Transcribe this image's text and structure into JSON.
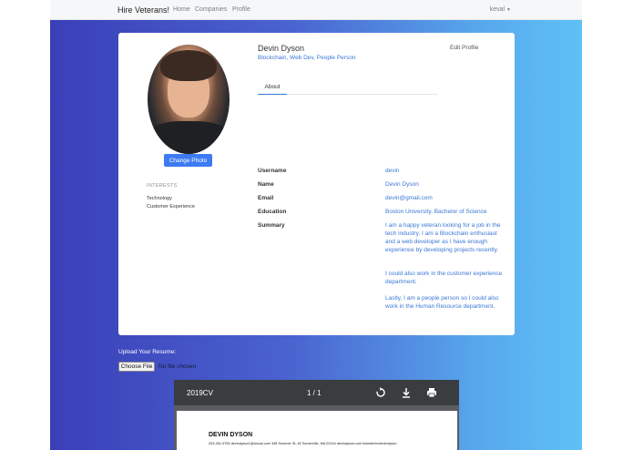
{
  "navbar": {
    "brand": "Hire Veterans!",
    "links": [
      "Home",
      "Companies",
      "Profile"
    ],
    "user": "keval"
  },
  "profile": {
    "name": "Devin Dyson",
    "tags": "Blockchain, Web Dev, People Person",
    "edit_label": "Edit Profile",
    "change_photo_label": "Change Photo",
    "tab_about": "About",
    "interests_title": "INTERESTS",
    "interests": [
      "Technology",
      "Customer Experience"
    ],
    "fields": [
      {
        "label": "Username",
        "value": "devin"
      },
      {
        "label": "Name",
        "value": "Devin Dyson"
      },
      {
        "label": "Email",
        "value": "devin@gmail.com"
      },
      {
        "label": "Education",
        "value": "Boston University, Bachelor of Science"
      },
      {
        "label": "Summary",
        "value": ""
      }
    ],
    "summary": [
      "I am a happy veteran looking for a job in the tech industry. I am a Blockchain enthusiast and a web developer as I have enough experience by developing projects recently.",
      "I could also work in the customer experience department.",
      "Lastly, I am a people person so I could also work in the Human Resource department."
    ]
  },
  "upload": {
    "title": "Upload Your Resume:",
    "choose_label": "Choose File",
    "status": "No file chosen"
  },
  "pdf": {
    "filename": "2019CV",
    "page_indicator": "1 / 1",
    "cv_name": "DEVIN DYSON",
    "cv_contact": "203-451-5755   devindyson1@icloud.com   348 Summer St, #2 Somerville, MA 02144   devindyson.com   linkedin/in/devindyson"
  }
}
